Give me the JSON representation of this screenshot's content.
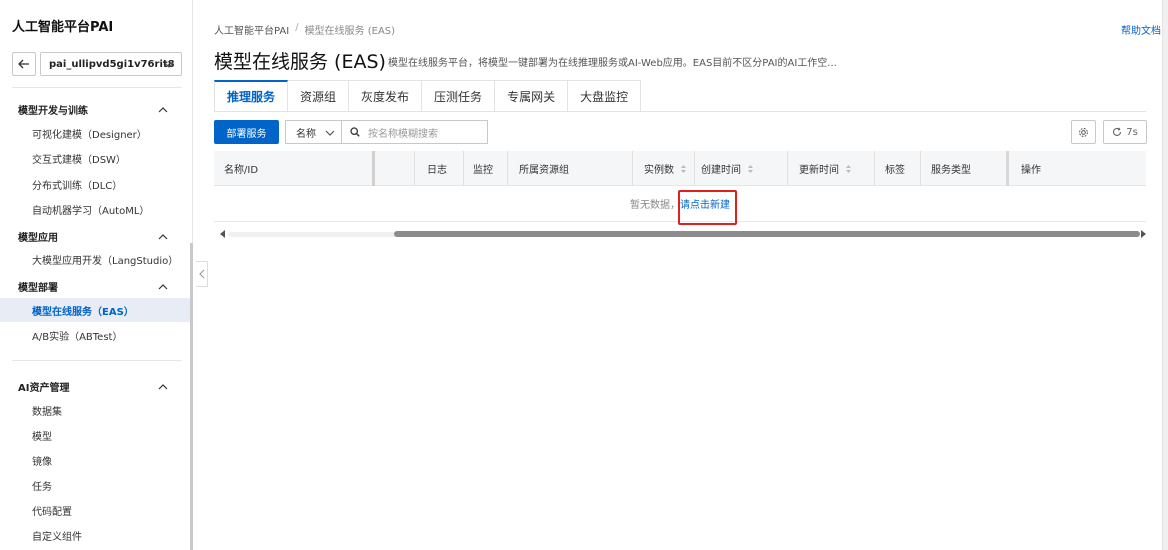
{
  "sidebar": {
    "title": "人工智能平台PAI",
    "workspace": "pai_ullipvd5gi1v76rit8",
    "groups": [
      {
        "label": "模型开发与训练",
        "items": [
          "可视化建模（Designer）",
          "交互式建模（DSW）",
          "分布式训练（DLC）",
          "自动机器学习（AutoML）"
        ]
      },
      {
        "label": "模型应用",
        "items": [
          "大模型应用开发（LangStudio）"
        ]
      },
      {
        "label": "模型部署",
        "items": [
          "模型在线服务（EAS）",
          "A/B实验（ABTest）"
        ]
      },
      {
        "label": "AI资产管理",
        "items": [
          "数据集",
          "模型",
          "镜像",
          "任务",
          "代码配置",
          "自定义组件"
        ]
      }
    ]
  },
  "header": {
    "breadcrumb": [
      "人工智能平台PAI",
      "模型在线服务 (EAS)"
    ],
    "help": "帮助文档",
    "title": "模型在线服务 (EAS)",
    "description": "模型在线服务平台，将模型一键部署为在线推理服务或AI-Web应用。EAS目前不区分PAI的AI工作空..."
  },
  "tabs": [
    "推理服务",
    "资源组",
    "灰度发布",
    "压测任务",
    "专属网关",
    "大盘监控"
  ],
  "toolbar": {
    "deploy": "部署服务",
    "filter": "名称",
    "search_placeholder": "按名称模糊搜索",
    "refresh": "7s"
  },
  "table": {
    "columns": [
      "名称/ID",
      "日志",
      "监控",
      "所属资源组",
      "实例数",
      "创建时间",
      "更新时间",
      "标签",
      "服务类型",
      "操作"
    ],
    "empty_text": "暂无数据，",
    "empty_link": "请点击新建"
  },
  "colors": {
    "accent": "#0064c8",
    "highlight": "#e02020"
  }
}
